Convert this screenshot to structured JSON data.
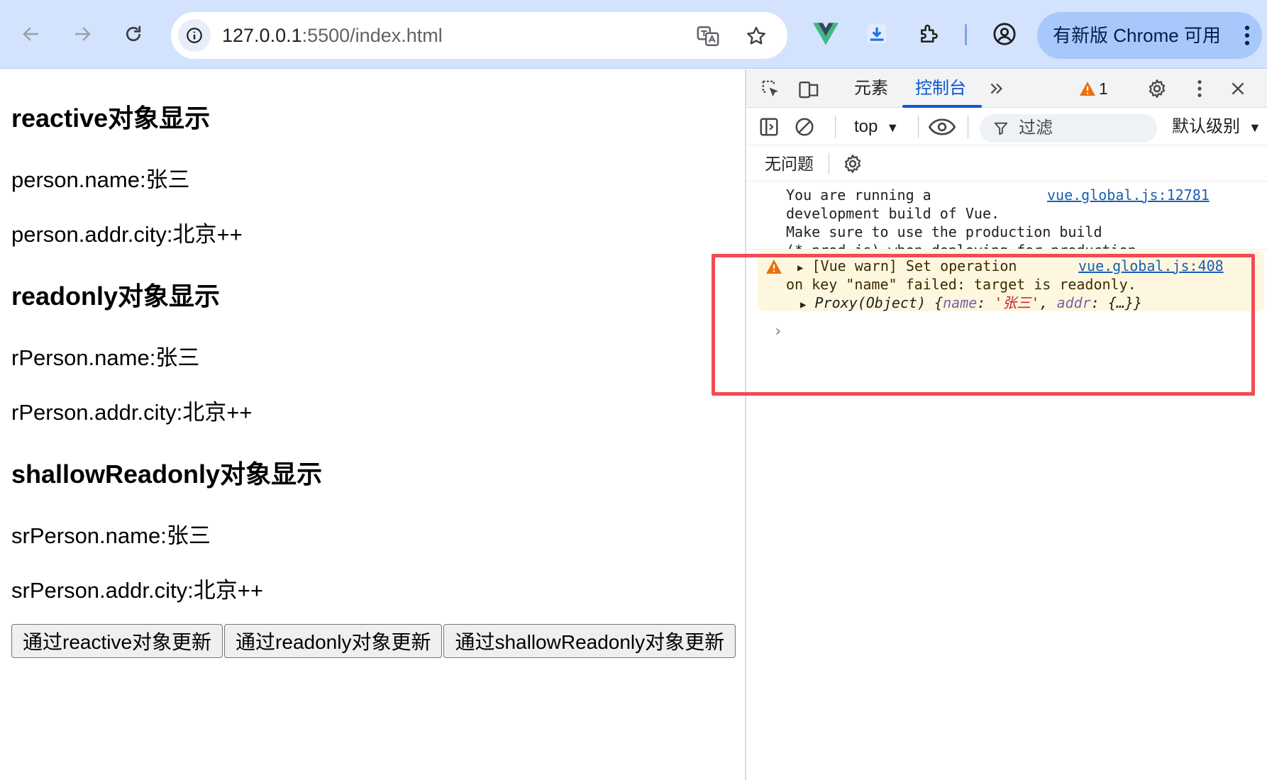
{
  "browser": {
    "url_host": "127.0.0.1",
    "url_rest": ":5500/index.html",
    "update_label": "有新版 Chrome 可用",
    "icons": [
      "back-icon",
      "forward-icon",
      "reload-icon",
      "info-icon",
      "translate-icon",
      "star-icon",
      "vue-devtools-icon",
      "download-icon",
      "extensions-icon",
      "profile-icon",
      "more-icon"
    ]
  },
  "page": {
    "sections": [
      {
        "heading": "reactive对象显示",
        "name_line": "person.name:张三",
        "city_line": "person.addr.city:北京++"
      },
      {
        "heading": "readonly对象显示",
        "name_line": "rPerson.name:张三",
        "city_line": "rPerson.addr.city:北京++"
      },
      {
        "heading": "shallowReadonly对象显示",
        "name_line": "srPerson.name:张三",
        "city_line": "srPerson.addr.city:北京++"
      }
    ],
    "buttons": [
      "通过reactive对象更新",
      "通过readonly对象更新",
      "通过shallowReadonly对象更新"
    ]
  },
  "devtools": {
    "tabs": {
      "elements": "元素",
      "console": "控制台"
    },
    "warning_count": "1",
    "context": "top",
    "filter_placeholder": "过滤",
    "levels": "默认级别",
    "issues": "无问题",
    "log_message": {
      "lines": [
        "You are running a",
        "development build of Vue.",
        "Make sure to use the production build",
        "(*.prod.js) when deploying for production."
      ],
      "source": "vue.global.js:12781"
    },
    "warn_message": {
      "line1": "[Vue warn] Set operation",
      "line2": "on key \"name\" failed: target is readonly.",
      "source": "vue.global.js:408",
      "proxy_label": "Proxy(Object)",
      "obj_open": " {",
      "key_name": "name",
      "val_name": "'张三'",
      "key_addr": "addr",
      "val_addr": "{…}}"
    },
    "colors": {
      "accent": "#0b57d0",
      "warn_bg": "#fef7e0",
      "highlight": "#f24b56"
    }
  }
}
